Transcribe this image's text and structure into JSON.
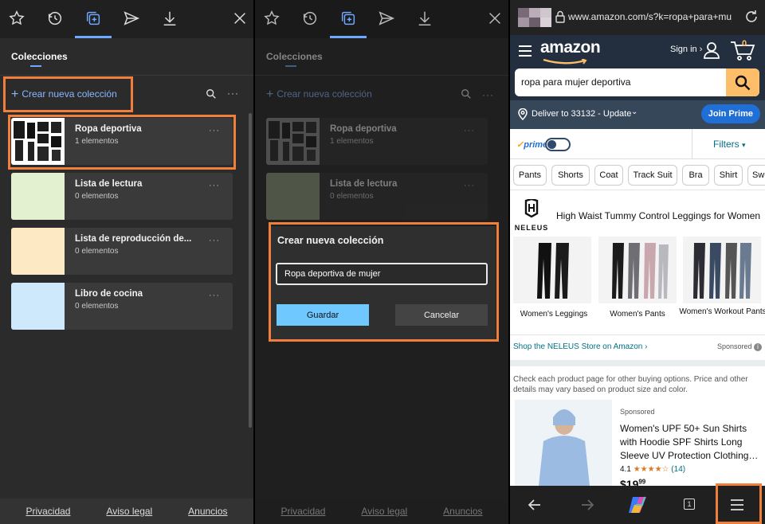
{
  "panel1": {
    "tabs": [
      "star-icon",
      "history-icon",
      "collections-icon",
      "share-icon",
      "download-icon",
      "close-icon"
    ],
    "heading": "Colecciones",
    "new_collection": "Crear nueva colección",
    "collections": [
      {
        "name": "Ropa deportiva",
        "count": "1 elementos",
        "thumb": "#ffffff"
      },
      {
        "name": "Lista de lectura",
        "count": "0 elementos",
        "thumb": "#e3f1d1"
      },
      {
        "name": "Lista de reproducción de...",
        "count": "0 elementos",
        "thumb": "#fde9c4"
      },
      {
        "name": "Libro de cocina",
        "count": "0 elementos",
        "thumb": "#cde9fb"
      }
    ],
    "footer": [
      "Privacidad",
      "Aviso legal",
      "Anuncios"
    ]
  },
  "panel2": {
    "heading": "Colecciones",
    "new_collection": "Crear nueva colección",
    "collections": [
      {
        "name": "Ropa deportiva",
        "count": "1 elementos"
      },
      {
        "name": "Lista de lectura",
        "count": "0 elementos"
      }
    ],
    "dialog": {
      "title": "Crear nueva colección",
      "value": "Ropa deportiva de mujer",
      "save": "Guardar",
      "cancel": "Cancelar"
    },
    "footer": [
      "Privacidad",
      "Aviso legal",
      "Anuncios"
    ]
  },
  "panel3": {
    "url": "www.amazon.com/s?k=ropa+para+muj",
    "logo": "amazon",
    "signin": "Sign in ›",
    "cart_count": "0",
    "search_query": "ropa para mujer deportiva",
    "deliver": "Deliver to 33132 - Update",
    "join_prime": "Join Prime",
    "prime": "prime",
    "filters": "Filters",
    "chips": [
      "Pants",
      "Shorts",
      "Coat",
      "Track Suit",
      "Bra",
      "Shirt",
      "Sw"
    ],
    "brand_logo": "NELEUS",
    "brand_title": "High Waist Tummy Control Leggings for Women",
    "products": [
      "Women's Leggings",
      "Women's Pants",
      "Women's Workout Pants"
    ],
    "shop_link": "Shop the NELEUS Store on Amazon ›",
    "sponsored": "Sponsored",
    "disclaimer": "Check each product page for other buying options. Price and other details may vary based on product size and color.",
    "result": {
      "sponsored": "Sponsored",
      "title": "Women's UPF 50+ Sun Shirts with Hoodie SPF Shirts Long Sleeve UV Protection Clothing…",
      "rating": "4.1",
      "reviews": "(14)",
      "price": "$19",
      "price_cents": "99"
    },
    "tab_count": "1"
  },
  "colors": {
    "accent": "#6ea8ff",
    "highlight": "#f07f3c",
    "amazon_nav": "#232f3e",
    "amazon_search_btn": "#febd69"
  }
}
